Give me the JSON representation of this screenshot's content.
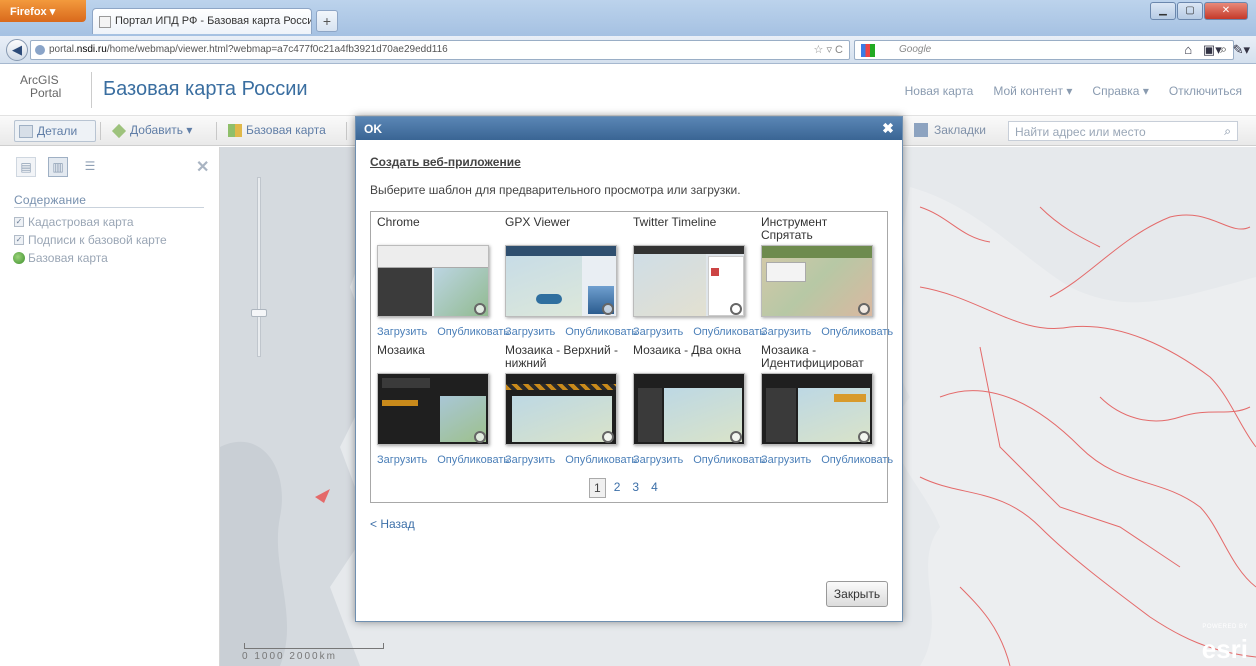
{
  "browser": {
    "app_button": "Firefox",
    "tab_title": "Портал ИПД РФ - Базовая карта России",
    "new_tab": "+",
    "url_prefix": "portal.",
    "url_domain": "nsdi.ru",
    "url_rest": "/home/webmap/viewer.html?webmap=a7c477f0c21a4fb3921d70ae29edd116",
    "search_placeholder": "Google"
  },
  "portal": {
    "logo_top": "ArcGIS",
    "logo_bottom": "Portal",
    "title": "Базовая карта России",
    "nav": [
      "Новая карта",
      "Мой контент ▾",
      "Справка ▾",
      "Отключиться"
    ]
  },
  "toolbar": {
    "details": "Детали",
    "add": "Добавить ▾",
    "basemap": "Базовая карта",
    "bookmarks": "Закладки",
    "find_placeholder": "Найти адрес или место"
  },
  "sidebar": {
    "contents_heading": "Содержание",
    "layers": [
      "Кадастровая карта",
      "Подписи к базовой карте",
      "Базовая карта"
    ]
  },
  "map": {
    "scale_labels": "0      1000      2000km",
    "esri_small": "POWERED BY",
    "esri": "esri"
  },
  "modal": {
    "title": "OK",
    "create_link": "Создать веб-приложение",
    "instruction": "Выберите шаблон для предварительного просмотра или загрузки.",
    "templates": [
      {
        "name": "Chrome",
        "thumb_accent": "#6f7f8f"
      },
      {
        "name": "GPX Viewer",
        "thumb_accent": "#2f6f9f"
      },
      {
        "name": "Twitter Timeline",
        "thumb_accent": "#9aa8b6"
      },
      {
        "name": "Инструмент Спрятать",
        "thumb_accent": "#7a8f6f"
      },
      {
        "name": "Мозаика",
        "thumb_accent": "#2b2b2b"
      },
      {
        "name": "Мозаика - Верхний - нижний",
        "thumb_accent": "#2b2b2b"
      },
      {
        "name": "Мозаика - Два окна",
        "thumb_accent": "#2b2b2b"
      },
      {
        "name": "Мозаика - Идентифицироват",
        "thumb_accent": "#2b2b2b"
      }
    ],
    "download_label": "Загрузить",
    "publish_label": "Опубликовать",
    "pages": [
      "1",
      "2",
      "3",
      "4"
    ],
    "back_link": "< Назад",
    "close_button": "Закрыть"
  }
}
